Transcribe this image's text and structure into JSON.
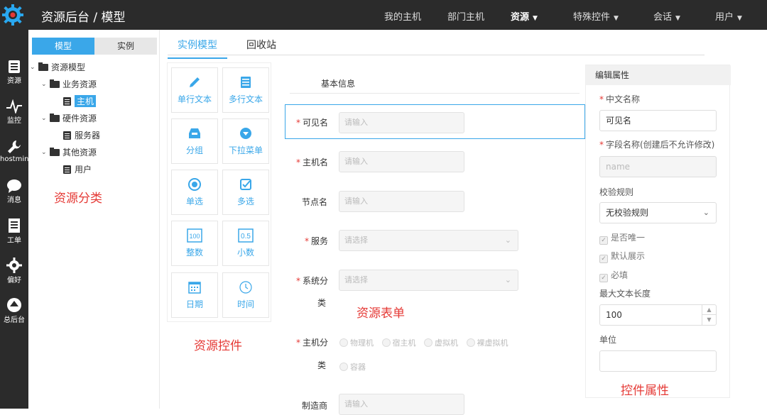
{
  "header": {
    "title": "资源后台 / 模型",
    "nav": [
      {
        "label": "我的主机",
        "dropdown": false
      },
      {
        "label": "部门主机",
        "dropdown": false
      },
      {
        "label": "资源",
        "dropdown": true,
        "active": true
      },
      {
        "label": "特殊控件",
        "dropdown": true
      },
      {
        "label": "会话",
        "dropdown": true
      },
      {
        "label": "用户",
        "dropdown": true
      }
    ]
  },
  "sidebar": {
    "items": [
      {
        "label": "资源",
        "icon": "document-icon"
      },
      {
        "label": "监控",
        "icon": "pulse-icon"
      },
      {
        "label": "hostmin",
        "icon": "wrench-icon"
      },
      {
        "label": "消息",
        "icon": "chat-icon"
      },
      {
        "label": "工单",
        "icon": "ticket-icon"
      },
      {
        "label": "偏好",
        "icon": "gear-icon"
      },
      {
        "label": "总后台",
        "icon": "upload-icon"
      }
    ]
  },
  "tree": {
    "tabs": [
      "模型",
      "实例"
    ],
    "root": "资源模型",
    "groups": [
      {
        "label": "业务资源",
        "children": [
          "主机"
        ]
      },
      {
        "label": "硬件资源",
        "children": [
          "服务器"
        ]
      },
      {
        "label": "其他资源",
        "children": [
          "用户"
        ]
      }
    ]
  },
  "main": {
    "tabs": [
      "实例模型",
      "回收站"
    ]
  },
  "controls": [
    {
      "label": "单行文本",
      "icon": "pencil-icon"
    },
    {
      "label": "多行文本",
      "icon": "list-icon"
    },
    {
      "label": "分组",
      "icon": "inbox-icon"
    },
    {
      "label": "下拉菜单",
      "icon": "dropdown-icon"
    },
    {
      "label": "单选",
      "icon": "radio-icon"
    },
    {
      "label": "多选",
      "icon": "checkbox-icon"
    },
    {
      "label": "整数",
      "icon": "integer-icon",
      "glyph": "100"
    },
    {
      "label": "小数",
      "icon": "decimal-icon",
      "glyph": "0.5"
    },
    {
      "label": "日期",
      "icon": "calendar-icon"
    },
    {
      "label": "时间",
      "icon": "clock-icon"
    }
  ],
  "form": {
    "section": "基本信息",
    "fields": [
      {
        "label": "可见名",
        "required": true,
        "placeholder": "请输入"
      },
      {
        "label": "主机名",
        "required": true,
        "placeholder": "请输入"
      },
      {
        "label": "节点名",
        "required": false,
        "placeholder": "请输入"
      },
      {
        "label": "服务",
        "required": true,
        "placeholder": "请选择"
      },
      {
        "label": "系统分",
        "label2": "类",
        "required": true,
        "placeholder": "请选择"
      },
      {
        "label": "主机分",
        "label2": "类",
        "required": true,
        "options": [
          "物理机",
          "宿主机",
          "虚拟机",
          "裸虚拟机",
          "容器"
        ]
      },
      {
        "label": "制造商",
        "required": false,
        "placeholder": "请输入"
      }
    ]
  },
  "properties": {
    "title": "编辑属性",
    "cn_name_label": "中文名称",
    "cn_name_value": "可见名",
    "field_name_label": "字段名称(创建后不允许修改)",
    "field_name_placeholder": "name",
    "rule_label": "校验规则",
    "rule_value": "无校验规则",
    "checks": [
      "是否唯一",
      "默认展示",
      "必填"
    ],
    "maxlen_label": "最大文本长度",
    "maxlen_value": "100",
    "unit_label": "单位",
    "unit_value": ""
  },
  "annotations": {
    "tree": "资源分类",
    "controls": "资源控件",
    "form": "资源表单",
    "props": "控件属性"
  },
  "colors": {
    "accent": "#3aa7e9",
    "topbar": "#2b2b2b",
    "annotation": "#e53935"
  }
}
